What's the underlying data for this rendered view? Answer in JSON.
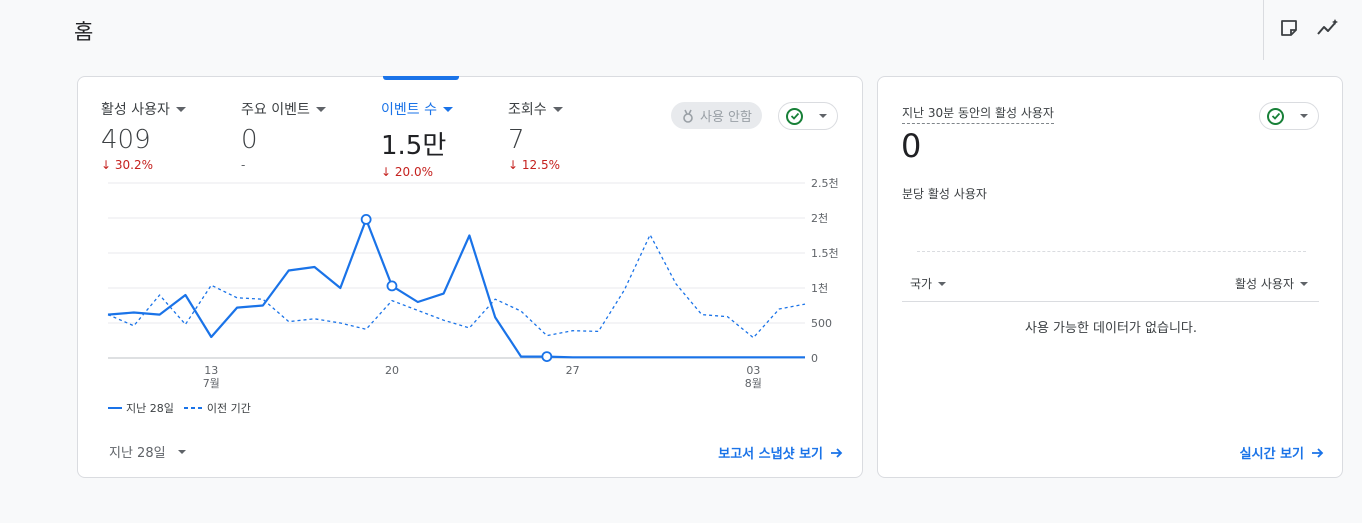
{
  "header": {
    "title": "홈"
  },
  "main_card": {
    "metrics": [
      {
        "label": "활성 사용자",
        "value": "409",
        "delta": "30.2%",
        "trend": "down",
        "active": false
      },
      {
        "label": "주요 이벤트",
        "value": "0",
        "delta": "-",
        "trend": "none",
        "active": false
      },
      {
        "label": "이벤트 수",
        "value": "1.5만",
        "delta": "20.0%",
        "trend": "down",
        "active": true
      },
      {
        "label": "조회수",
        "value": "7",
        "delta": "12.5%",
        "trend": "down",
        "active": false
      }
    ],
    "insights_chip": "사용 안함",
    "legend": {
      "current": "지난 28일",
      "previous": "이전 기간"
    },
    "date_range": "지난 28일",
    "report_link": "보고서 스냅샷 보기"
  },
  "chart_data": {
    "type": "line",
    "x": [
      "07-09",
      "07-10",
      "07-11",
      "07-12",
      "07-13",
      "07-14",
      "07-15",
      "07-16",
      "07-17",
      "07-18",
      "07-19",
      "07-20",
      "07-21",
      "07-22",
      "07-23",
      "07-24",
      "07-25",
      "07-26",
      "07-27",
      "07-28",
      "07-29",
      "07-30",
      "07-31",
      "08-01",
      "08-02",
      "08-03",
      "08-04",
      "08-05"
    ],
    "x_ticks": [
      {
        "label": "13",
        "sub": "7월",
        "index": 4
      },
      {
        "label": "20",
        "sub": "",
        "index": 11
      },
      {
        "label": "27",
        "sub": "",
        "index": 18
      },
      {
        "label": "03",
        "sub": "8월",
        "index": 25
      }
    ],
    "y_ticks": [
      "0",
      "500",
      "1천",
      "1.5천",
      "2천",
      "2.5천"
    ],
    "ylim": [
      0,
      2500
    ],
    "series": [
      {
        "name": "지난 28일",
        "style": "solid",
        "values": [
          620,
          650,
          620,
          900,
          300,
          720,
          750,
          1250,
          1300,
          1000,
          1980,
          1030,
          800,
          920,
          1750,
          580,
          20,
          20,
          10,
          10,
          10,
          10,
          10,
          10,
          10,
          10,
          10,
          10
        ],
        "markers": [
          10,
          11,
          17
        ]
      },
      {
        "name": "이전 기간",
        "style": "dashed",
        "values": [
          620,
          460,
          900,
          480,
          1040,
          860,
          840,
          520,
          560,
          500,
          410,
          820,
          680,
          540,
          430,
          840,
          670,
          320,
          390,
          380,
          970,
          1760,
          1060,
          620,
          590,
          290,
          700,
          770
        ]
      }
    ],
    "color": "#1a73e8",
    "grid": true
  },
  "realtime_card": {
    "title": "지난 30분 동안의 활성 사용자",
    "value": "0",
    "subtitle": "분당 활성 사용자",
    "col_country": "국가",
    "col_users": "활성 사용자",
    "empty_text": "사용 가능한 데이터가 없습니다.",
    "link": "실시간 보기"
  }
}
